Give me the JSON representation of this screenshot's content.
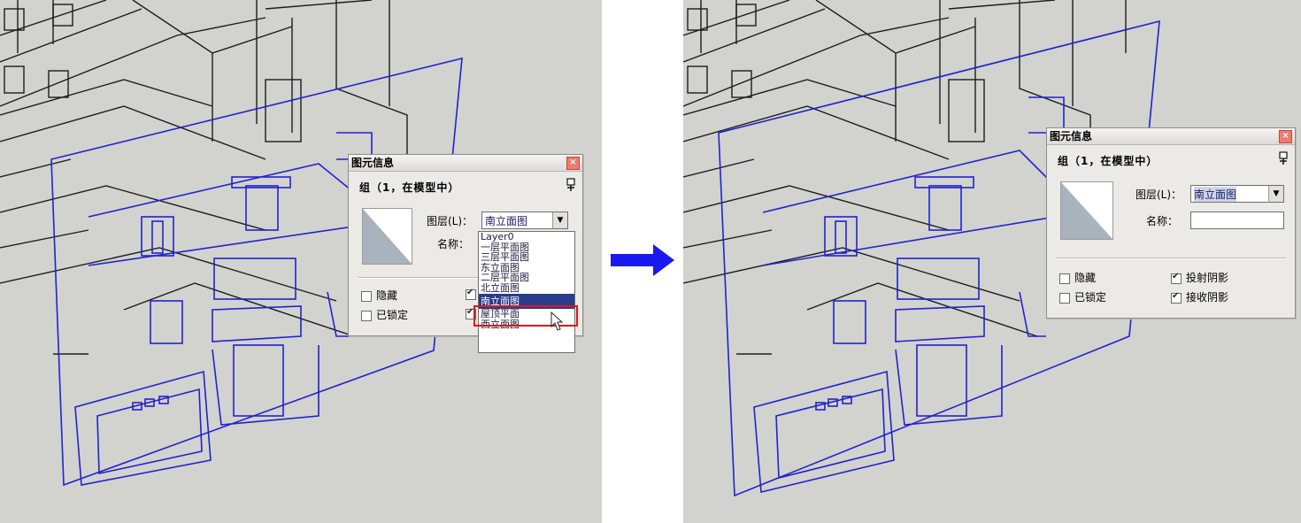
{
  "arrow": {
    "color": "#1a1aee"
  },
  "left": {
    "dialog": {
      "title": "图元信息",
      "close": "×",
      "subtitle": "组（1，在模型中）",
      "layer_label": "图层(L)：",
      "layer_value": "南立面图",
      "name_label": "名称：",
      "hidden_label": "隐藏",
      "locked_label": "已锁定",
      "dropdown_options": [
        "Layer0",
        "一层平面图",
        "三层平面图",
        "东立面图",
        "二层平面图",
        "北立面图",
        "南立面图",
        "屋顶平面",
        "西立面图"
      ],
      "selected_option": "南立面图"
    }
  },
  "right": {
    "dialog": {
      "title": "图元信息",
      "close": "×",
      "subtitle": "组（1，在模型中）",
      "layer_label": "图层(L)：",
      "layer_value": "南立面图",
      "name_label": "名称：",
      "name_value": "",
      "hidden_label": "隐藏",
      "locked_label": "已锁定",
      "cast_shadow_label": "投射阴影",
      "receive_shadow_label": "接收阴影",
      "cast_shadow_checked": true,
      "receive_shadow_checked": true
    }
  },
  "colors": {
    "scene_bg": "#d2d2cf",
    "blue_lines": "#2222cc",
    "black_lines": "#1c1c1c",
    "highlight": "#e01818"
  }
}
